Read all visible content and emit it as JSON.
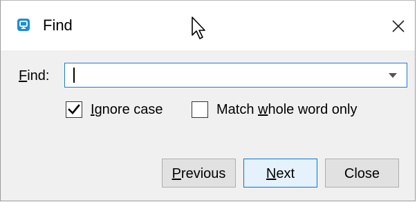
{
  "window": {
    "title": "Find",
    "icon": "app-logo-icon",
    "accent_color": "#1a8fd6"
  },
  "find": {
    "label": "Find:",
    "label_mnemonic": "F",
    "value": "",
    "options_icon": "chevron-down-icon"
  },
  "options": {
    "ignore_case": {
      "label": "Ignore case",
      "mnemonic": "I",
      "checked": true
    },
    "match_whole_word": {
      "label": "Match whole word only",
      "mnemonic": "w",
      "checked": false
    }
  },
  "buttons": {
    "previous": {
      "label": "Previous",
      "mnemonic": "P"
    },
    "next": {
      "label": "Next",
      "mnemonic": "N"
    },
    "close": {
      "label": "Close"
    }
  }
}
